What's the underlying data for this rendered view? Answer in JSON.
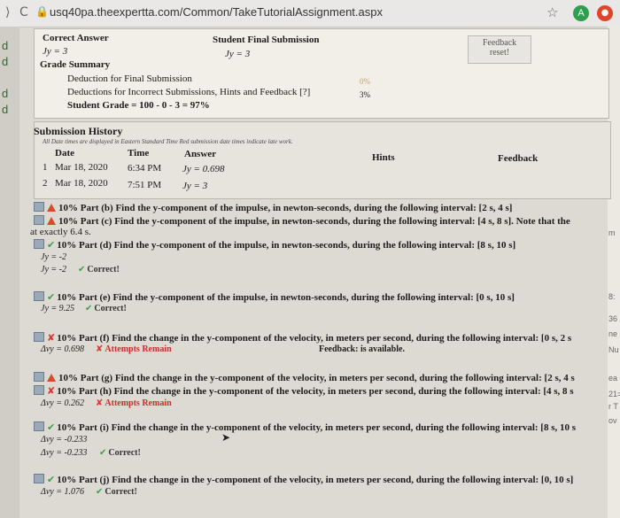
{
  "browser": {
    "back": "⟩",
    "reload": "C",
    "url": "usq40pa.theexpertta.com/Common/TakeTutorialAssignment.aspx",
    "star": "☆",
    "avatar_letter": "A",
    "ext_glyph": "●"
  },
  "left_strip": [
    "d",
    "d",
    "d",
    "d"
  ],
  "summary": {
    "correct_answer_label": "Correct Answer",
    "student_final_label": "Student Final Submission",
    "correct_answer_value": "Jy = 3",
    "student_final_value": "Jy = 3",
    "feedback_btn": "Feedback",
    "feedback_sub": "reset!",
    "grade_summary_label": "Grade Summary",
    "deduction_final": "Deduction for Final Submission",
    "deduction_final_pct": "0%",
    "deduction_incorrect": "Deductions for Incorrect Submissions, Hints and Feedback [?]",
    "deduction_incorrect_pct": "3%",
    "student_grade": "Student Grade = 100 - 0 - 3 = 97%"
  },
  "history": {
    "title": "Submission History",
    "note": "All Date times are displayed in Eastern Standard Time Red submission date times indicate late work.",
    "col_date": "Date",
    "col_time": "Time",
    "col_answer": "Answer",
    "col_hints": "Hints",
    "col_feedback": "Feedback",
    "rows": [
      {
        "n": "1",
        "date": "Mar 18, 2020",
        "time": "6:34 PM",
        "answer": "Jy = 0.698"
      },
      {
        "n": "2",
        "date": "Mar 18, 2020",
        "time": "7:51 PM",
        "answer": "Jy = 3"
      }
    ]
  },
  "parts": {
    "b": "10% Part (b)  Find the y-component of the impulse, in newton-seconds, during the following interval: [2 s, 4 s]",
    "c": "10% Part (c)  Find the y-component of the impulse, in newton-seconds, during the following interval: [4 s, 8 s]. Note that the",
    "c_cont": "at exactly 6.4 s.",
    "d": "10% Part (d)  Find the y-component of the impulse, in newton-seconds, during the following interval: [8 s, 10 s]",
    "d_a1": "Jy = -2",
    "d_a2": "Jy = -2",
    "d_status": "Correct!",
    "e": "10% Part (e)  Find the y-component of the impulse, in newton-seconds, during the following interval: [0 s, 10 s]",
    "e_ans": "Jy = 9.25",
    "e_status": "Correct!",
    "f": "10% Part (f)  Find the change in the y-component of the velocity, in meters per second, during the following interval: [0 s, 2 s",
    "f_ans": "Δvy = 0.698",
    "f_status": "Attempts Remain",
    "f_feedback": "Feedback: is available.",
    "g": "10% Part (g)  Find the change in the y-component of the velocity, in meters per second, during the following interval: [2 s, 4 s",
    "h": "10% Part (h)  Find the change in the y-component of the velocity, in meters per second, during the following interval: [4 s, 8 s",
    "h_ans": "Δvy = 0.262",
    "h_status": "Attempts Remain",
    "i": "10% Part (i)  Find the change in the y-component of the velocity, in meters per second, during the following interval: [8 s, 10 s",
    "i_a1": "Δvy = -0.233",
    "i_a2": "Δvy = -0.233",
    "i_status": "Correct!",
    "j": "10% Part (j)  Find the change in the y-component of the velocity, in meters per second, during the following interval: [0, 10 s]",
    "j_ans": "Δvy = 1.076",
    "j_status": "Correct!"
  },
  "right_strip": [
    "m",
    "8:",
    "36",
    "ne",
    "Nu",
    "ea",
    "21=",
    "r T",
    "ov"
  ]
}
